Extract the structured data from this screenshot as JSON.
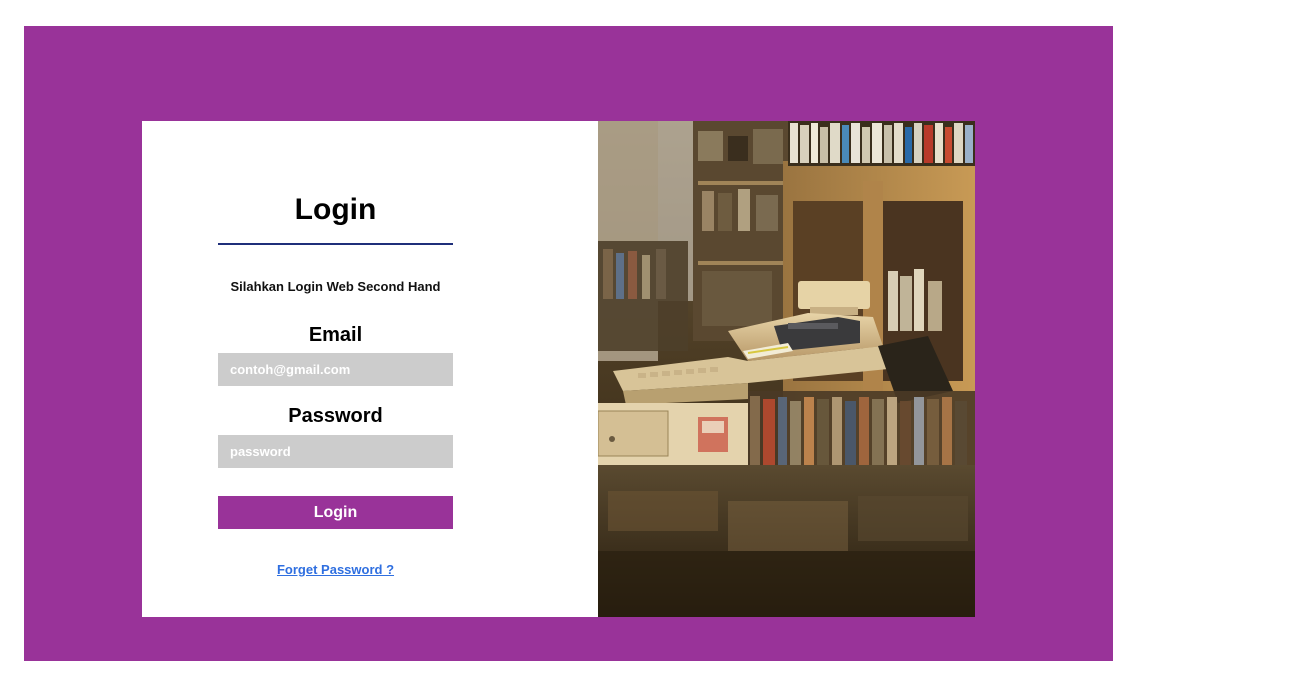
{
  "login": {
    "title": "Login",
    "subtitle": "Silahkan Login Web Second Hand",
    "email_label": "Email",
    "email_placeholder": "contoh@gmail.com",
    "password_label": "Password",
    "password_placeholder": "password",
    "submit_label": "Login",
    "forget_password_label": "Forget Password ?"
  },
  "colors": {
    "accent": "#993399",
    "input_background": "#cccccc",
    "underline": "#1f2f7a",
    "link": "#2f6fe0"
  },
  "hero_image": {
    "subject": "bookstore-cash-register-photo"
  }
}
